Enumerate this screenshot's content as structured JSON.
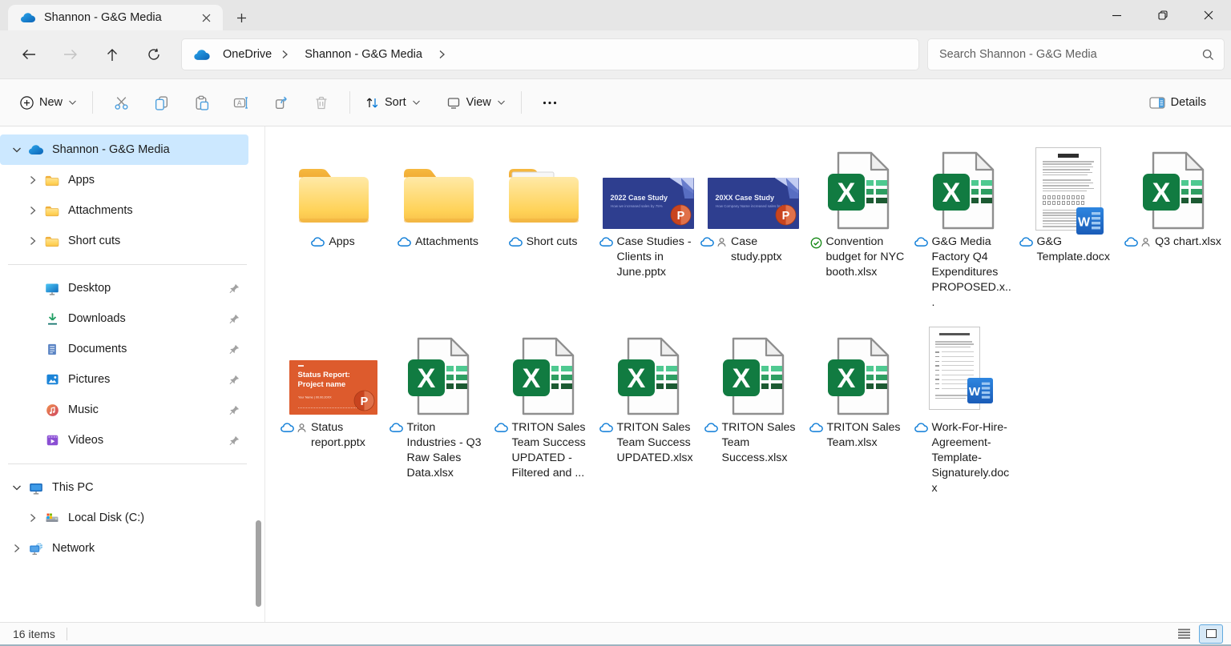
{
  "tab": {
    "title": "Shannon - G&G Media"
  },
  "nav": {
    "breadcrumb": [
      {
        "label": "OneDrive"
      },
      {
        "label": "Shannon - G&G Media"
      }
    ],
    "search_placeholder": "Search Shannon - G&G Media"
  },
  "toolbar": {
    "new": "New",
    "sort": "Sort",
    "view": "View",
    "details": "Details"
  },
  "sidebar": {
    "tree": [
      {
        "label": "Shannon - G&G Media",
        "icon": "onedrive",
        "chevron": "down",
        "indent": 0,
        "selected": true
      },
      {
        "label": "Apps",
        "icon": "folder",
        "chevron": "right",
        "indent": 1
      },
      {
        "label": "Attachments",
        "icon": "folder",
        "chevron": "right",
        "indent": 1
      },
      {
        "label": "Short cuts",
        "icon": "folder",
        "chevron": "right",
        "indent": 1
      },
      {
        "divider": true
      },
      {
        "label": "Desktop",
        "icon": "desktop",
        "indent": 1,
        "pinned": true
      },
      {
        "label": "Downloads",
        "icon": "downloads",
        "indent": 1,
        "pinned": true
      },
      {
        "label": "Documents",
        "icon": "documents",
        "indent": 1,
        "pinned": true
      },
      {
        "label": "Pictures",
        "icon": "pictures",
        "indent": 1,
        "pinned": true
      },
      {
        "label": "Music",
        "icon": "music",
        "indent": 1,
        "pinned": true
      },
      {
        "label": "Videos",
        "icon": "videos",
        "indent": 1,
        "pinned": true
      },
      {
        "divider": true
      },
      {
        "label": "This PC",
        "icon": "thispc",
        "chevron": "down",
        "indent": 0
      },
      {
        "label": "Local Disk (C:)",
        "icon": "disk",
        "chevron": "right",
        "indent": 1
      },
      {
        "label": "Network",
        "icon": "network",
        "chevron": "right",
        "indent": 0
      }
    ]
  },
  "files": [
    {
      "name": "Apps",
      "type": "folder",
      "status": [
        "cloud"
      ]
    },
    {
      "name": "Attachments",
      "type": "folder",
      "status": [
        "cloud"
      ]
    },
    {
      "name": "Short cuts",
      "type": "folder",
      "variant": "paper",
      "status": [
        "cloud"
      ]
    },
    {
      "name": "Case Studies - Clients in June.pptx",
      "type": "pptx-blue",
      "status": [
        "cloud"
      ],
      "thumb_title": "2022 Case Study",
      "thumb_sub": "How we increased sales by 75%"
    },
    {
      "name": "Case study.pptx",
      "type": "pptx-blue",
      "status": [
        "cloud",
        "people"
      ],
      "thumb_title": "20XX Case Study",
      "thumb_sub": "How Company Name increased sales by 75%"
    },
    {
      "name": "Convention budget for NYC booth.xlsx",
      "type": "xlsx",
      "status": [
        "check"
      ]
    },
    {
      "name": "G&G Media Factory Q4 Expenditures PROPOSED.x...",
      "type": "xlsx",
      "status": [
        "cloud"
      ]
    },
    {
      "name": "G&G Template.docx",
      "type": "docx",
      "status": [
        "cloud"
      ]
    },
    {
      "name": "Q3 chart.xlsx",
      "type": "xlsx",
      "status": [
        "cloud",
        "people"
      ]
    },
    {
      "name": "Status report.pptx",
      "type": "pptx-orange",
      "status": [
        "cloud",
        "people"
      ],
      "thumb_title": "Status Report:",
      "thumb_line2": "Project name",
      "thumb_footer": "Your Name | 00.00.20XX"
    },
    {
      "name": "Triton Industries - Q3 Raw Sales Data.xlsx",
      "type": "xlsx",
      "status": [
        "cloud"
      ]
    },
    {
      "name": "TRITON Sales Team Success UPDATED - Filtered and ...",
      "type": "xlsx",
      "status": [
        "cloud"
      ]
    },
    {
      "name": "TRITON Sales Team Success UPDATED.xlsx",
      "type": "xlsx",
      "status": [
        "cloud"
      ]
    },
    {
      "name": "TRITON Sales Team Success.xlsx",
      "type": "xlsx",
      "status": [
        "cloud"
      ]
    },
    {
      "name": "TRITON Sales Team.xlsx",
      "type": "xlsx",
      "status": [
        "cloud"
      ]
    },
    {
      "name": "Work-For-Hire-Agreement-Template-Signaturely.docx",
      "type": "docx-form",
      "status": [
        "cloud"
      ]
    }
  ],
  "statusbar": {
    "count": "16 items"
  },
  "colors": {
    "selection": "#cce8ff",
    "accent": "#0067c0",
    "excel_green": "#107c41",
    "folder_yellow": "#ffce55",
    "ppt_blue": "#2e3e8f",
    "ppt_orange": "#dd5b2d",
    "word_blue": "#2b7cd3"
  }
}
